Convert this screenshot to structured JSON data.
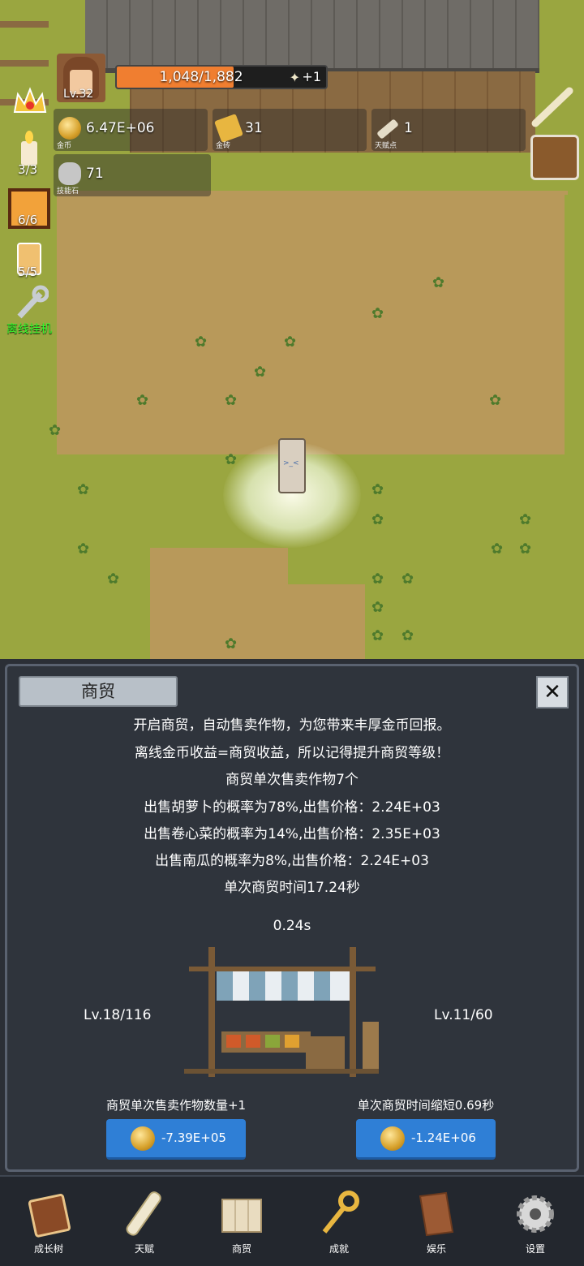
{
  "hud": {
    "level": "Lv.32",
    "hp_text": "1,048/1,882",
    "hp_fraction": 0.557,
    "hp_plus": "+1",
    "gold_value": "6.47E+06",
    "gold_caption": "金币",
    "brick_value": "31",
    "brick_caption": "金砖",
    "talent_value": "1",
    "talent_caption": "天赋点",
    "stone_value": "71",
    "stone_caption": "技能石",
    "candle_count": "3/3",
    "box_count": "6/6",
    "drink_count": "5/5",
    "offline_label": "离线挂机"
  },
  "panel": {
    "title": "商贸",
    "lines": [
      "开启商贸，自动售卖作物，为您带来丰厚金币回报。",
      "离线金币收益=商贸收益，所以记得提升商贸等级！",
      "商贸单次售卖作物7个",
      "出售胡萝卜的概率为78%,出售价格：2.24E+03",
      "出售卷心菜的概率为14%,出售价格：2.35E+03",
      "出售南瓜的概率为8%,出售价格：2.24E+03",
      "单次商贸时间17.24秒"
    ],
    "timer": "0.24s",
    "left_level": "Lv.18/116",
    "right_level": "Lv.11/60",
    "left_upgrade_caption": "商贸单次售卖作物数量+1",
    "right_upgrade_caption": "单次商贸时间缩短0.69秒",
    "left_cost": "-7.39E+05",
    "right_cost": "-1.24E+06"
  },
  "nav": {
    "items": [
      {
        "label": "成长树",
        "icon": "book-icon"
      },
      {
        "label": "天赋",
        "icon": "scroll-icon"
      },
      {
        "label": "商贸",
        "icon": "map-icon"
      },
      {
        "label": "成就",
        "icon": "key-icon"
      },
      {
        "label": "娱乐",
        "icon": "parchment-icon"
      },
      {
        "label": "设置",
        "icon": "gear-icon"
      }
    ]
  }
}
